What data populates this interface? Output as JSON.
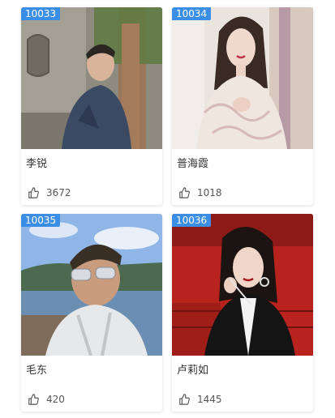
{
  "cards": [
    {
      "id": "10033",
      "name": "李锐",
      "likes": "3672",
      "photo": "photo-man-jacket"
    },
    {
      "id": "10034",
      "name": "普海霞",
      "likes": "1018",
      "photo": "photo-woman-lace"
    },
    {
      "id": "10035",
      "name": "毛东",
      "likes": "420",
      "photo": "photo-man-sunglasses"
    },
    {
      "id": "10036",
      "name": "卢莉如",
      "likes": "1445",
      "photo": "photo-woman-red"
    }
  ],
  "colors": {
    "badge": "#3a8ee6",
    "name_text": "#333333",
    "likes_text": "#555555"
  },
  "icons": {
    "like": "thumbs-up-icon"
  }
}
